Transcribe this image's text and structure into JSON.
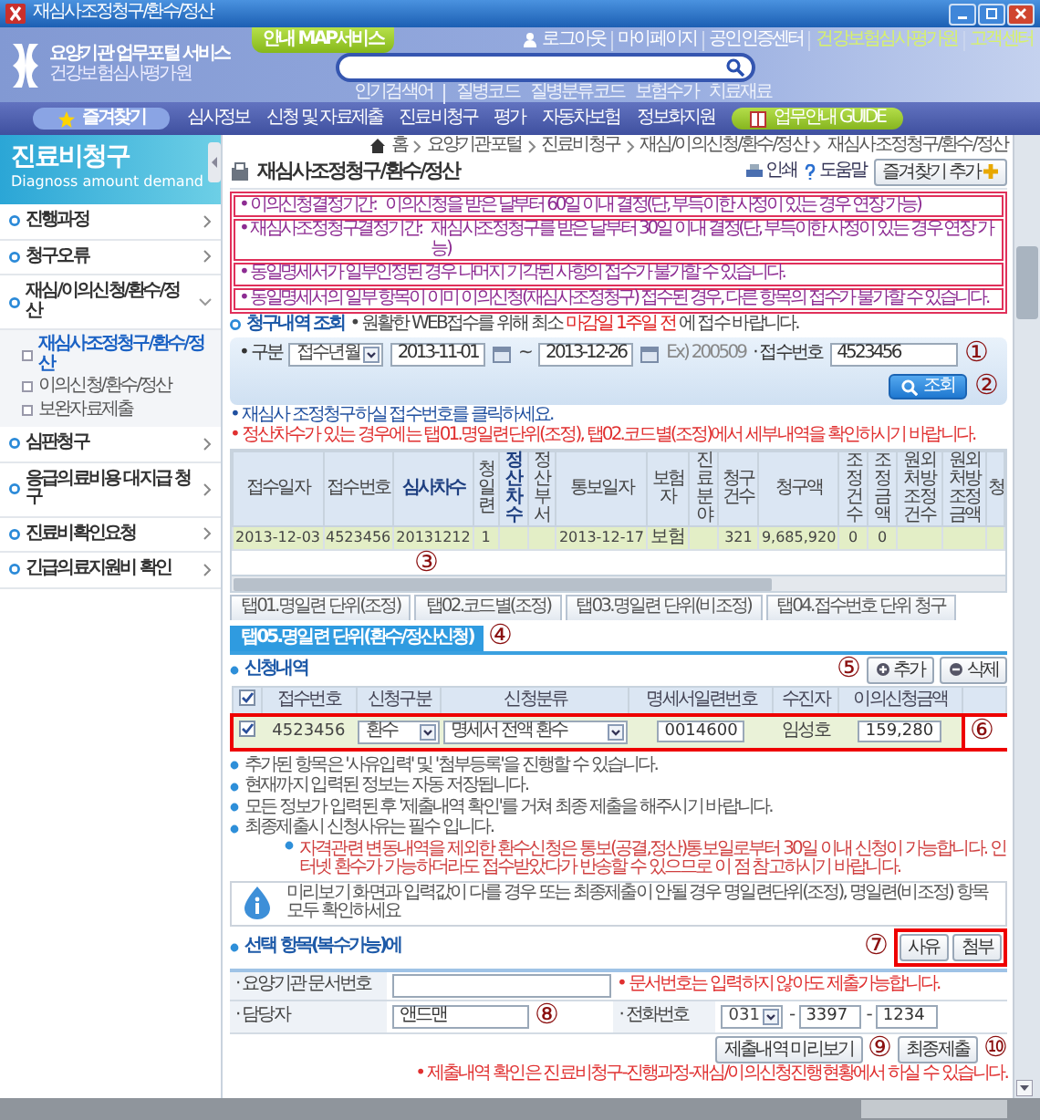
{
  "window": {
    "title": "재심사조정청구/환수/정산"
  },
  "header": {
    "logo_title": "요양기관 업무포털 서비스",
    "logo_subtitle": "건강보험심사평가원",
    "map_tab": "안내 MAP서비스",
    "top_links": [
      {
        "label": "로그아웃",
        "kind": "account"
      },
      {
        "label": "마이페이지",
        "kind": "account"
      },
      {
        "label": "공인인증센터",
        "kind": "account"
      },
      {
        "label": "건강보험심사평가원",
        "kind": "org"
      },
      {
        "label": "고객센터",
        "kind": "org"
      }
    ],
    "popular_label": "인기검색어",
    "popular": [
      "질병코드",
      "질병분류코드",
      "보험수가",
      "치료재료"
    ]
  },
  "nav": {
    "favorites": "즐겨찾기",
    "items": [
      "심사정보",
      "신청 및 자료제출",
      "진료비청구",
      "평가",
      "자동차보험",
      "정보화지원"
    ],
    "guide": "업무안내 GUIDE"
  },
  "sidebar": {
    "title": "진료비청구",
    "subtitle": "Diagnoss amount demand",
    "items": [
      {
        "label": "진행과정",
        "expanded": false
      },
      {
        "label": "청구오류",
        "expanded": false
      },
      {
        "label": "재심/이의신청/환수/정산",
        "expanded": true,
        "children": [
          {
            "label": "재심사조정청구/환수/정산",
            "selected": true
          },
          {
            "label": "이의신청/환수/정산",
            "selected": false
          },
          {
            "label": "보완자료제출",
            "selected": false
          }
        ]
      },
      {
        "label": "심판청구",
        "expanded": false
      },
      {
        "label": "응급의료비용 대지급 청구",
        "expanded": false
      },
      {
        "label": "진료비확인요청",
        "expanded": false
      },
      {
        "label": "긴급의료지원비 확인",
        "expanded": false
      }
    ]
  },
  "breadcrumb": [
    "홈",
    "요양기관포털",
    "진료비청구",
    "재심/이의신청/환수/정산",
    "재심사조정청구/환수/정산"
  ],
  "page_title": "재심사조정청구/환수/정산",
  "tools": [
    "인쇄",
    "도움말"
  ],
  "favorite_add": "즐겨찾기 추가",
  "notices": [
    {
      "label": "• 이의신청결정기간:",
      "text": "이의신청을 받은 날부터 60일 이내 결정(단, 부득이한 사정이 있는 경우 연장 가능)"
    },
    {
      "label": "• 재심사조정청구결정기간:",
      "text": "재심사조정청구를 받은 날부터 30일 이내 결정(단, 부득이한 사정이 있는 경우 연장 가능)"
    },
    {
      "text": "• 동일명세서가 일부인정된 경우 나머지 기각된 사항의 접수가 불가할 수 있습니다."
    },
    {
      "text": "• 동일명세서의 일부 항목이 이미 이의신청(재심사조정청구) 접수된 경우, 다른 항목의 접수가 불가할 수 있습니다."
    }
  ],
  "search_section": {
    "title": "청구내역 조회",
    "note": "• 원활한 WEB접수를 위해 최소 **마감일 1주일 전** 에 접수 바랍니다."
  },
  "search": {
    "type_label": "• 구분",
    "type_value": "접수년월",
    "date_from": "2013-11-01",
    "range": "~",
    "date_to": "2013-12-26",
    "example": "Ex) 200509",
    "receipt_label": "· 접수번호",
    "receipt_value": "4523456",
    "button": "조회"
  },
  "hints": [
    "• 재심사 조정청구하실 접수번호를 클릭하세요.",
    "• 정산차수가 있는 경우에는 탭01.명일련단위(조정), 탭02.코드별(조정)에서 세부내역을 확인하시기 바랍니다."
  ],
  "claims_table": {
    "columns": [
      "접수일자",
      "접수번호",
      "심사차수",
      "청일련",
      "정산차수",
      "정산부서",
      "통보일자",
      "보험자",
      "진료분야",
      "청구건수",
      "청구액",
      "조정건수",
      "조정금액",
      "원외처방 조정건수",
      "원외처방 조정금액",
      "청"
    ],
    "rows": [
      {
        "selected": true,
        "cells": [
          "2013-12-03",
          "4523456",
          "20131212",
          "1",
          null,
          null,
          "2013-12-17",
          "보험",
          null,
          "321",
          "9,685,920",
          "0",
          "0",
          null,
          null,
          null
        ]
      }
    ]
  },
  "tabs": [
    {
      "label": "탭01.명일련 단위(조정)",
      "selected": false
    },
    {
      "label": "탭02.코드별(조정)",
      "selected": false
    },
    {
      "label": "탭03.명일련 단위(비조정)",
      "selected": false
    },
    {
      "label": "탭04.접수번호 단위 청구",
      "selected": false
    },
    {
      "label": "탭05.명일련 단위(환수/정산신청)",
      "selected": true
    }
  ],
  "requests": {
    "title": "신청내역",
    "buttons": [
      "추가",
      "삭제"
    ],
    "all_checked": true,
    "columns": [
      "접수번호",
      "신청구분",
      "신청분류",
      "명세서일련번호",
      "수진자",
      "이의신청금액"
    ],
    "rows": [
      {
        "checked": true,
        "highlighted": true,
        "receipt_no": "4523456",
        "type": "환수",
        "category": "명세서 전액 환수",
        "statement_no": "0014600",
        "patient": "임성호",
        "amount": "159,280"
      }
    ]
  },
  "notes": [
    "추가된 항목은 '사유입력' 및 '첨부등록'을 진행할 수 있습니다.",
    "현재까지 입력된 정보는 자동 저장됩니다.",
    "모든 정보가 입력된 후 '제출내역 확인'를 거쳐 최종 제출을 해주시기 바랍니다.",
    "최종제출시 신청사유는 필수 입니다."
  ],
  "warning": "자격관련 변동내역을 제외한 환수신청은 통보(공결,정산)통보일로부터 30일 이내 신청이 가능합니다. 인터넷 환수가 가능하더라도 접수받았다가 반송할 수 있으므로 이 점 참고하시기 바랍니다.",
  "info": "미리보기 화면과 입력값이 다를 경우 또는 최종제출이 안될 경우 명일련단위(조정), 명일련(비조정) 항목 모두 확인하세요",
  "selection": {
    "title": "선택 항목(복수가능)에",
    "buttons": [
      "사유",
      "첨부"
    ],
    "highlighted": true
  },
  "form": {
    "doc_label": "· 요양기관 문서번호",
    "doc_hint": "• 문서번호는 입력하지 않아도 제출가능합니다.",
    "manager_label": "· 담당자",
    "manager_value": "앤드맨",
    "phone_label": "· 전화번호",
    "phone": [
      "031",
      "3397",
      "1234"
    ],
    "separators": [
      "-",
      "-"
    ]
  },
  "actions": {
    "buttons": [
      "제출내역 미리보기",
      "최종제출"
    ],
    "note": "• 제출내역 확인은 진료비청구-진행과정-재심/이의신청진행현황에서 하실 수 있습니다."
  },
  "markers": [
    "①",
    "②",
    "③",
    "④",
    "⑤",
    "⑥",
    "⑦",
    "⑧",
    "⑨",
    "⑩"
  ]
}
